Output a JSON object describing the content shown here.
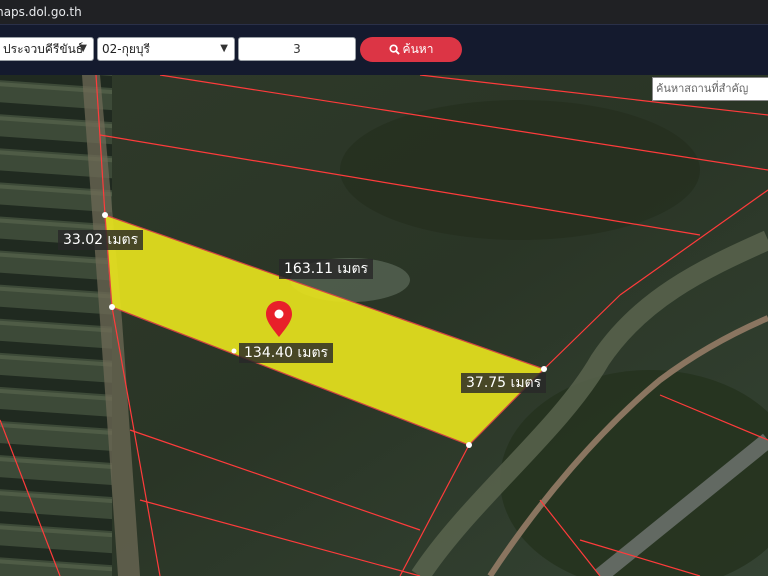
{
  "browser": {
    "url": "maps.dol.go.th"
  },
  "toolbar": {
    "province": "ประจวบคีรีขันธ์",
    "district": "02-กุยบุรี",
    "parcel_number": "3",
    "search_label": "ค้นหา"
  },
  "map": {
    "place_search_placeholder": "ค้นหาสถานที่สำคัญ",
    "distances": {
      "west": "33.02 เมตร",
      "north": "163.11 เมตร",
      "south": "134.40 เมตร",
      "east": "37.75 เมตร"
    },
    "parcel_color": "#e6e21e",
    "boundary_color": "#ff3b3b",
    "marker_color": "#e8202a"
  }
}
